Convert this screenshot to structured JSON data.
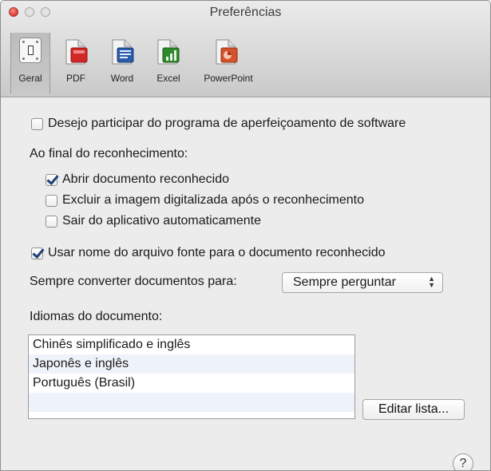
{
  "window": {
    "title": "Preferências"
  },
  "toolbar": {
    "tabs": [
      {
        "id": "geral",
        "label": "Geral",
        "selected": true,
        "icon": "general-switch-icon"
      },
      {
        "id": "pdf",
        "label": "PDF",
        "selected": false,
        "icon": "pdf-document-icon",
        "color": "#d22727"
      },
      {
        "id": "word",
        "label": "Word",
        "selected": false,
        "icon": "word-document-icon",
        "color": "#2a5caa"
      },
      {
        "id": "excel",
        "label": "Excel",
        "selected": false,
        "icon": "excel-document-icon",
        "color": "#2f8a2a"
      },
      {
        "id": "ppt",
        "label": "PowerPoint",
        "selected": false,
        "icon": "powerpoint-document-icon",
        "color": "#d5532b"
      }
    ]
  },
  "settings": {
    "improvement_program": {
      "label": "Desejo participar do programa de aperfeiçoamento de software",
      "checked": false
    },
    "after_recognition_heading": "Ao final do reconhecimento:",
    "open_document": {
      "label": "Abrir documento reconhecido",
      "checked": true
    },
    "delete_image": {
      "label": "Excluir a imagem digitalizada após o reconhecimento",
      "checked": false
    },
    "quit_app": {
      "label": "Sair do aplicativo automaticamente",
      "checked": false
    },
    "use_source_name": {
      "label": "Usar nome do arquivo fonte para o documento reconhecido",
      "checked": true
    },
    "convert_label": "Sempre converter documentos para:",
    "convert_value": "Sempre perguntar",
    "languages_heading": "Idiomas do documento:",
    "languages": [
      "Chinês simplificado e inglês",
      "Japonês e inglês",
      "Português (Brasil)"
    ],
    "edit_list_label": "Editar lista...",
    "help_label": "?"
  }
}
